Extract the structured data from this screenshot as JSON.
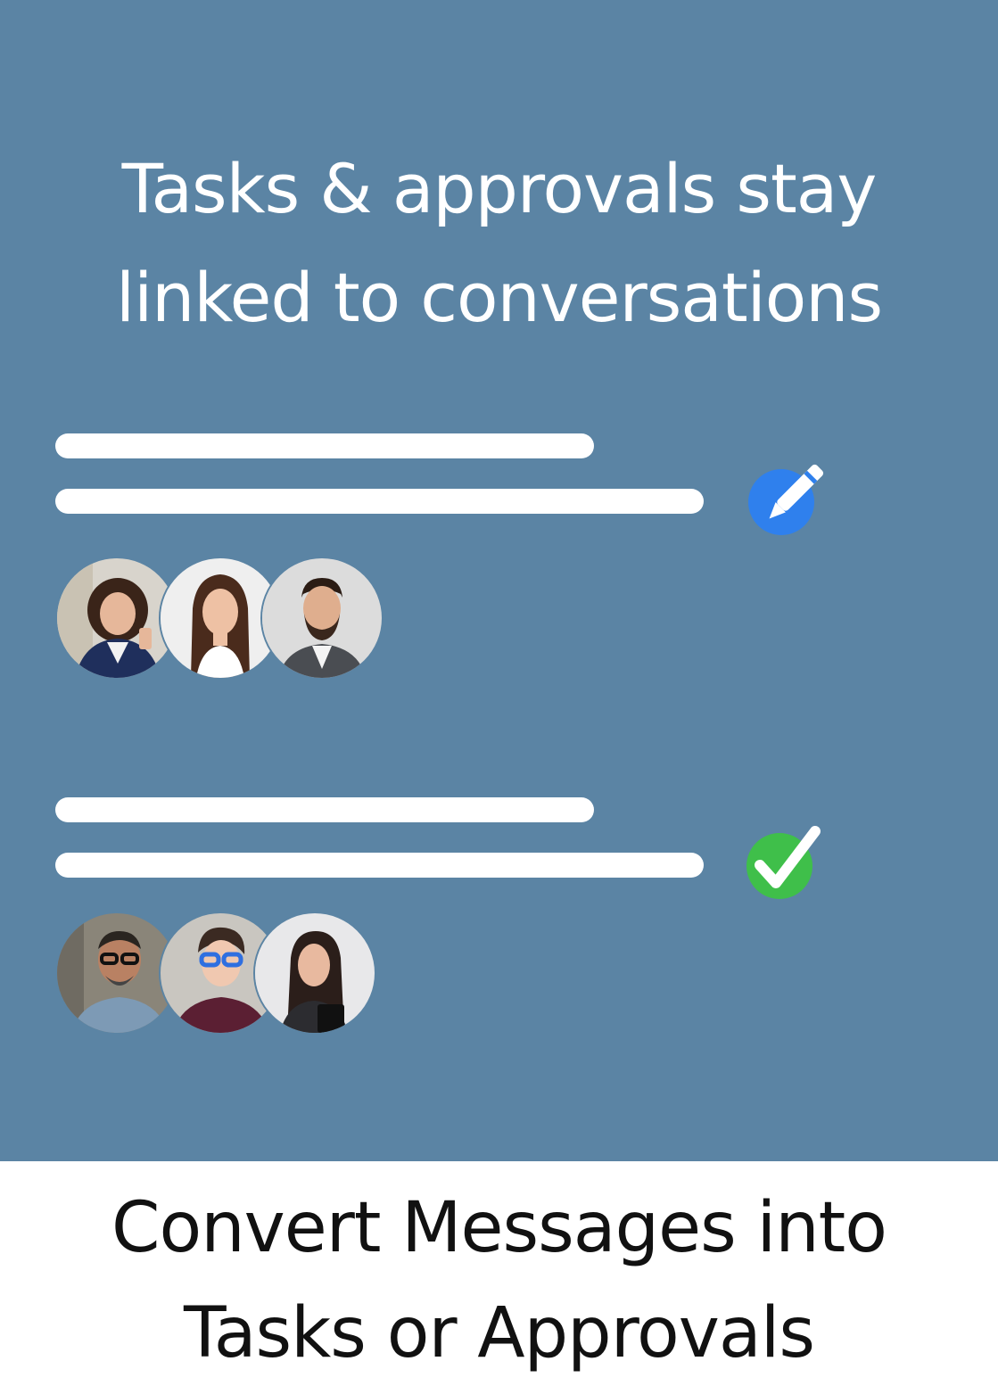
{
  "headline": {
    "line1": "Tasks & approvals stay",
    "line2": "linked to conversations"
  },
  "caption": {
    "line1": "Convert Messages into",
    "line2": "Tasks or Approvals"
  },
  "colors": {
    "panel_background": "#5b84a4",
    "edit_icon_blue": "#2f80ed",
    "check_icon_green": "#3fbf4a"
  },
  "items": [
    {
      "status_icon": "pencil-edit-icon",
      "participants": [
        "woman-with-phone",
        "woman-long-hair",
        "man-beard-suit"
      ]
    },
    {
      "status_icon": "check-approved-icon",
      "participants": [
        "man-glasses-smiling",
        "man-blue-glasses",
        "woman-with-clipboard"
      ]
    }
  ]
}
